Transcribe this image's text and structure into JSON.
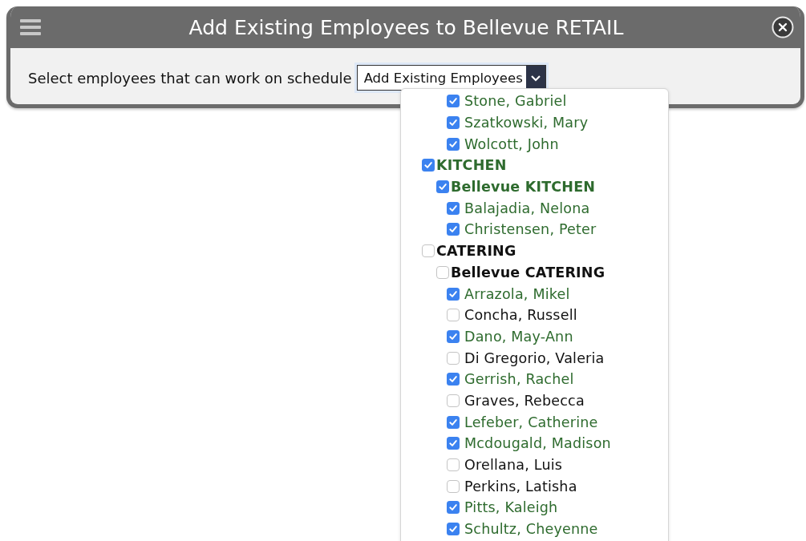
{
  "dialog": {
    "title": "Add Existing Employees to Bellevue RETAIL"
  },
  "prompt": "Select employees that can work on schedule",
  "dropdown": {
    "value": "Add Existing Employees",
    "expanded": true
  },
  "options": [
    {
      "kind": "employee",
      "label": "Stone, Gabriel",
      "checked": true
    },
    {
      "kind": "employee",
      "label": "Szatkowski, Mary",
      "checked": true
    },
    {
      "kind": "employee",
      "label": "Wolcott, John",
      "checked": true
    },
    {
      "kind": "department",
      "label": "KITCHEN",
      "checked": true,
      "children": [
        {
          "kind": "location",
          "label": "Bellevue KITCHEN",
          "checked": true,
          "children": [
            {
              "kind": "employee",
              "label": "Balajadia, Nelona",
              "checked": true
            },
            {
              "kind": "employee",
              "label": "Christensen, Peter",
              "checked": true
            }
          ]
        }
      ]
    },
    {
      "kind": "department",
      "label": "CATERING",
      "checked": false,
      "children": [
        {
          "kind": "location",
          "label": "Bellevue CATERING",
          "checked": false,
          "children": [
            {
              "kind": "employee",
              "label": "Arrazola, Mikel",
              "checked": true
            },
            {
              "kind": "employee",
              "label": "Concha, Russell",
              "checked": false
            },
            {
              "kind": "employee",
              "label": "Dano, May-Ann",
              "checked": true
            },
            {
              "kind": "employee",
              "label": "Di Gregorio, Valeria",
              "checked": false
            },
            {
              "kind": "employee",
              "label": "Gerrish, Rachel",
              "checked": true
            },
            {
              "kind": "employee",
              "label": "Graves, Rebecca",
              "checked": false
            },
            {
              "kind": "employee",
              "label": "Lefeber, Catherine",
              "checked": true
            },
            {
              "kind": "employee",
              "label": "Mcdougald, Madison",
              "checked": true
            },
            {
              "kind": "employee",
              "label": "Orellana, Luis",
              "checked": false
            },
            {
              "kind": "employee",
              "label": "Perkins, Latisha",
              "checked": false
            },
            {
              "kind": "employee",
              "label": "Pitts, Kaleigh",
              "checked": true
            },
            {
              "kind": "employee",
              "label": "Schultz, Cheyenne",
              "checked": true
            }
          ]
        }
      ]
    }
  ]
}
